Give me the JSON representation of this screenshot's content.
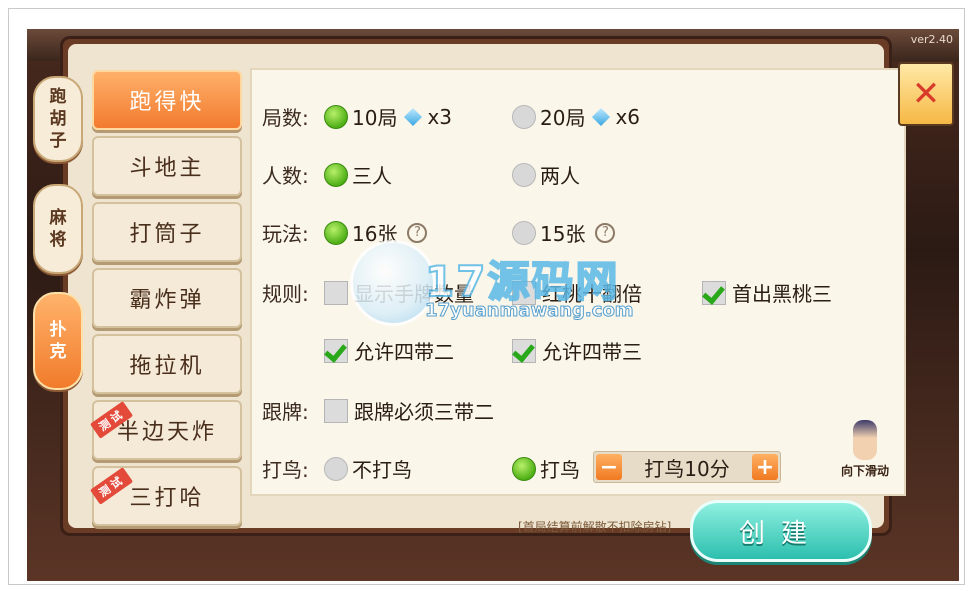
{
  "version": "ver2.40",
  "categories": [
    {
      "label": [
        "跑",
        "胡",
        "子"
      ],
      "active": false
    },
    {
      "label": [
        "麻",
        "将"
      ],
      "active": false
    },
    {
      "label": [
        "扑",
        "克"
      ],
      "active": true
    }
  ],
  "games": [
    {
      "label": "跑得快",
      "active": true,
      "badge": ""
    },
    {
      "label": "斗地主",
      "active": false,
      "badge": ""
    },
    {
      "label": "打筒子",
      "active": false,
      "badge": ""
    },
    {
      "label": "霸炸弹",
      "active": false,
      "badge": ""
    },
    {
      "label": "拖拉机",
      "active": false,
      "badge": ""
    },
    {
      "label": "半边天炸",
      "active": false,
      "badge": "测试"
    },
    {
      "label": "三打哈",
      "active": false,
      "badge": "测试"
    }
  ],
  "settings": {
    "rounds": {
      "label": "局数:",
      "options": [
        {
          "text": "10局",
          "cost": "x3",
          "selected": true
        },
        {
          "text": "20局",
          "cost": "x6",
          "selected": false
        }
      ]
    },
    "players": {
      "label": "人数:",
      "options": [
        {
          "text": "三人",
          "selected": true
        },
        {
          "text": "两人",
          "selected": false
        }
      ]
    },
    "mode": {
      "label": "玩法:",
      "options": [
        {
          "text": "16张",
          "help": "?",
          "selected": true
        },
        {
          "text": "15张",
          "help": "?",
          "selected": false
        }
      ]
    },
    "rules": {
      "label": "规则:",
      "options": [
        {
          "text": "显示手牌数量",
          "checked": false
        },
        {
          "text": "红桃十翻倍",
          "checked": false
        },
        {
          "text": "首出黑桃三",
          "checked": true
        },
        {
          "text": "允许四带二",
          "checked": true
        },
        {
          "text": "允许四带三",
          "checked": true
        }
      ]
    },
    "follow": {
      "label": "跟牌:",
      "options": [
        {
          "text": "跟牌必须三带二",
          "checked": false
        }
      ]
    },
    "bird": {
      "label": "打鸟:",
      "options": [
        {
          "text": "不打鸟",
          "selected": false
        },
        {
          "text": "打鸟",
          "selected": true
        }
      ],
      "stepper": {
        "minus": "−",
        "value": "打鸟10分",
        "plus": "+"
      }
    }
  },
  "note": "[首局结算前解散不扣除房钻]",
  "create_label": "创建",
  "scroll_hint": "向下滑动",
  "close_icon": "✕",
  "watermark": {
    "text": "17源码网",
    "url": "17yuanmawang.com"
  }
}
